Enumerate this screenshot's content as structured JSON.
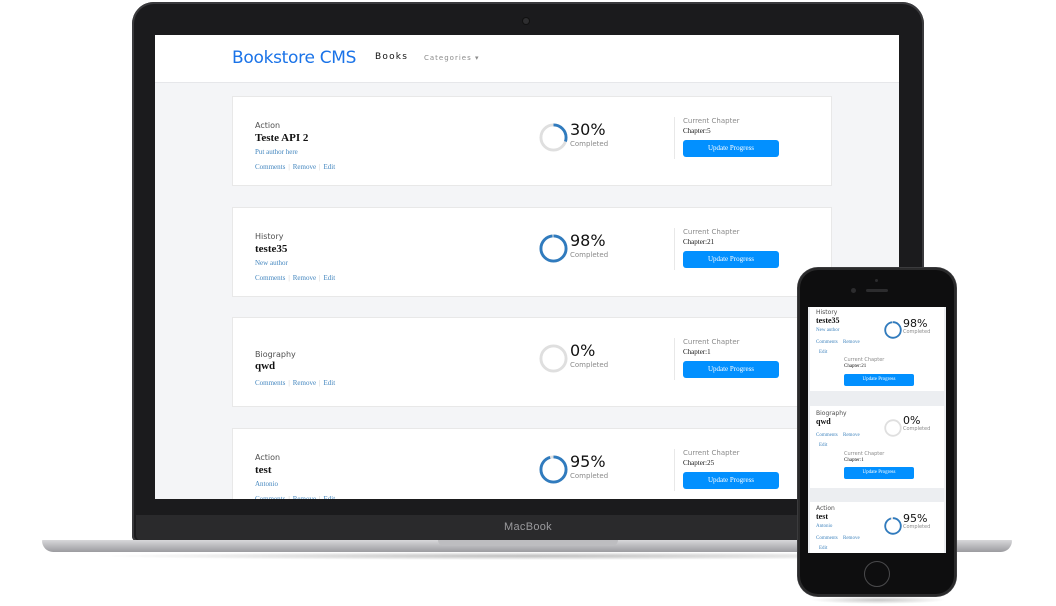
{
  "device": {
    "laptop_label": "MacBook"
  },
  "app": {
    "brand": "Bookstore CMS",
    "nav": {
      "books": "Books",
      "categories": "Categories ▾"
    },
    "labels": {
      "completed": "Completed",
      "current_chapter": "Current Chapter",
      "update_button": "Update Progress",
      "comments": "Comments",
      "remove": "Remove",
      "edit": "Edit"
    },
    "accent_color": "#0290ff",
    "brand_color": "#1a73e8",
    "progress_color": "#307bbe",
    "books": [
      {
        "genre": "Action",
        "title": "Teste API 2",
        "author": "Put author here",
        "percent": "30%",
        "progress": 0.3,
        "chapter": "Chapter:5"
      },
      {
        "genre": "History",
        "title": "teste35",
        "author": "New author",
        "percent": "98%",
        "progress": 0.98,
        "chapter": "Chapter:21"
      },
      {
        "genre": "Biography",
        "title": "qwd",
        "author": "",
        "percent": "0%",
        "progress": 0.0,
        "chapter": "Chapter:1"
      },
      {
        "genre": "Action",
        "title": "test",
        "author": "Antonio",
        "percent": "95%",
        "progress": 0.95,
        "chapter": "Chapter:25"
      }
    ]
  },
  "mobile": {
    "books": [
      {
        "genre": "History",
        "title": "teste35",
        "author": "New author",
        "percent": "98%",
        "progress": 0.98,
        "chapter": "Chapter:21"
      },
      {
        "genre": "Biography",
        "title": "qwd",
        "author": "",
        "percent": "0%",
        "progress": 0.0,
        "chapter": "Chapter:1"
      },
      {
        "genre": "Action",
        "title": "test",
        "author": "Antonio",
        "percent": "95%",
        "progress": 0.95,
        "chapter": ""
      }
    ]
  }
}
